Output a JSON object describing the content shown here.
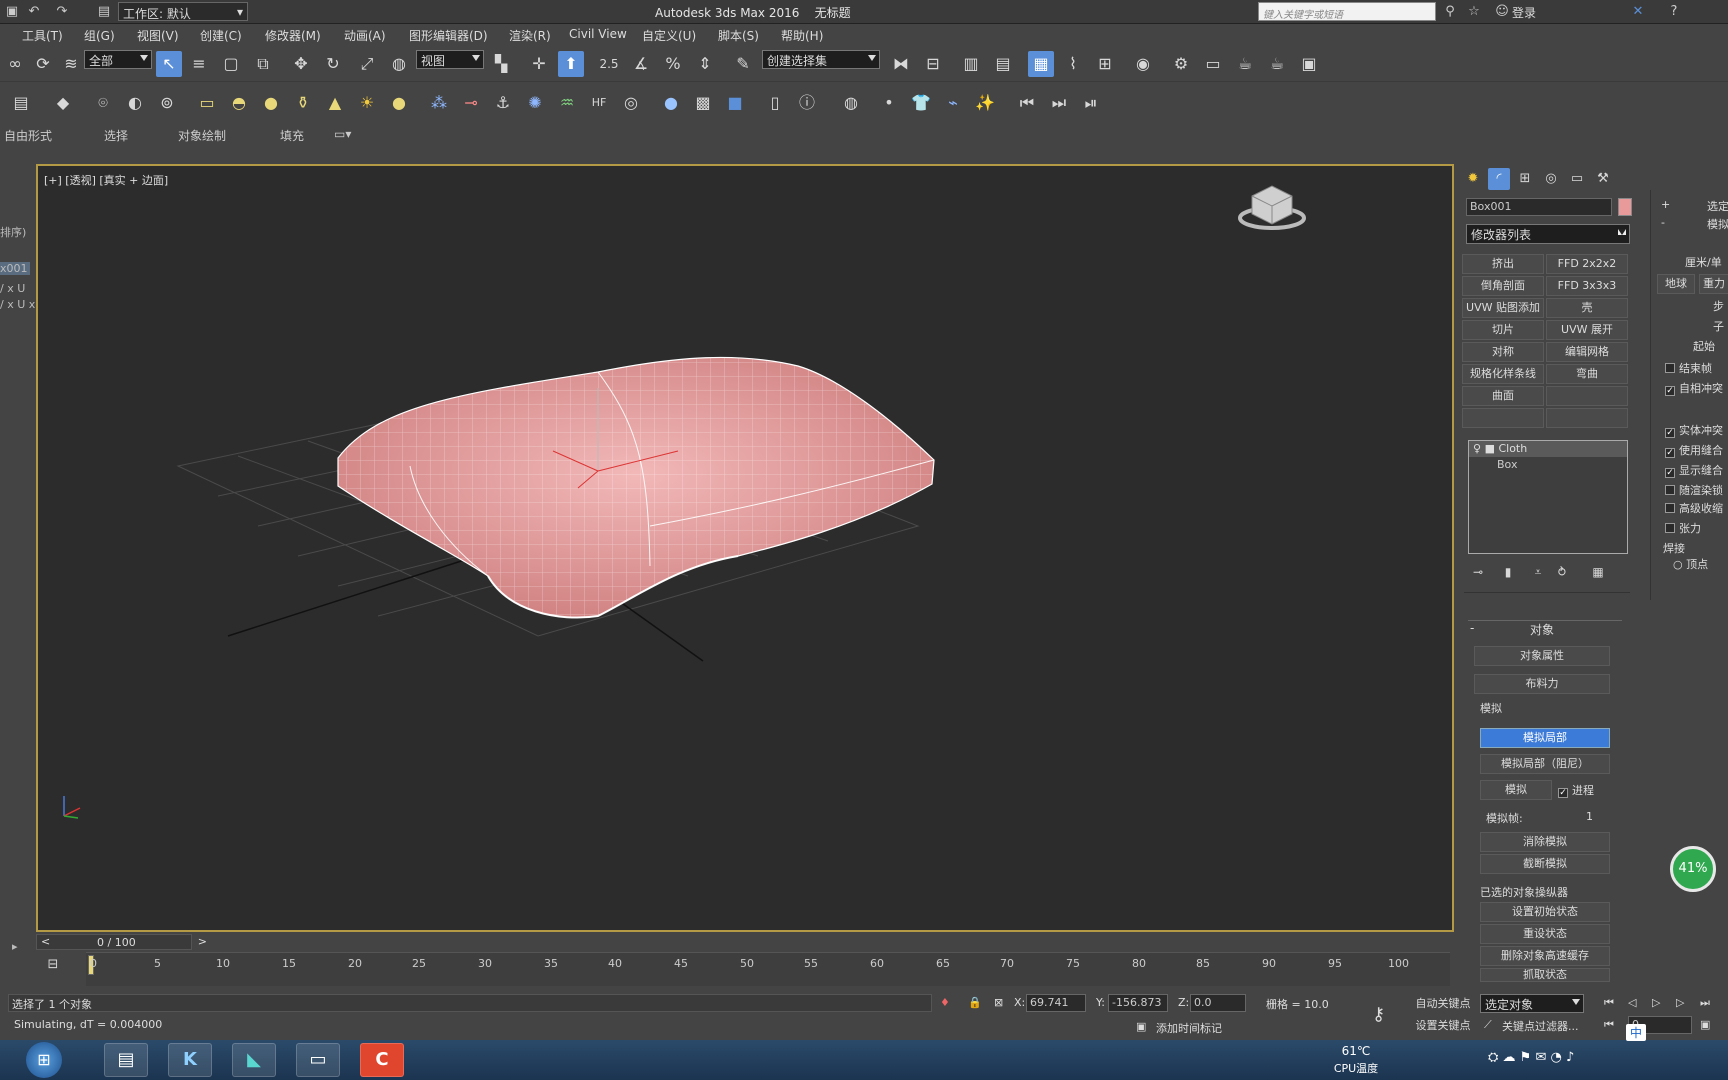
{
  "title": {
    "app": "Autodesk 3ds Max 2016",
    "doc": "无标题",
    "workspace": "工作区: 默认",
    "search_placeholder": "键入关键字或短语",
    "login": "登录"
  },
  "menu": [
    "工具(T)",
    "组(G)",
    "视图(V)",
    "创建(C)",
    "修改器(M)",
    "动画(A)",
    "图形编辑器(D)",
    "渲染(R)",
    "Civil View",
    "自定义(U)",
    "脚本(S)",
    "帮助(H)"
  ],
  "toolbar": {
    "filter": "全部",
    "refcoord": "视图",
    "named_sel": "创建选择集",
    "snap_angle": "2.5"
  },
  "ribbon": [
    "自由形式",
    "选择",
    "对象绘制",
    "填充"
  ],
  "leftpanel": [
    "排序)",
    "x001",
    "/ x U",
    "/ x U x"
  ],
  "viewport": {
    "label": "[+] [透视] [真实 + 边面]"
  },
  "cmd": {
    "object_name": "Box001",
    "object_color": "#e89a9a",
    "modlist": "修改器列表",
    "mod_buttons": [
      [
        "挤出",
        "FFD 2x2x2"
      ],
      [
        "倒角剖面",
        "FFD 3x3x3"
      ],
      [
        "UVW 贴图添加",
        "壳"
      ],
      [
        "切片",
        "UVW 展开"
      ],
      [
        "对称",
        "编辑网格"
      ],
      [
        "规格化样条线",
        "弯曲"
      ],
      [
        "曲面",
        ""
      ]
    ],
    "stack": [
      "Cloth",
      "Box"
    ],
    "rollout_title": "对象",
    "obj_props": "对象属性",
    "cloth_forces": "布料力",
    "sim_group": "模拟",
    "sim_local": "模拟局部",
    "sim_local_damped": "模拟局部（阻尼）",
    "simulate": "模拟",
    "progress": "进程",
    "sim_frame_label": "模拟帧:",
    "sim_frame_value": "1",
    "erase_sim": "消除模拟",
    "truncate_sim": "截断模拟",
    "sel_group": "已选的对象操纵器",
    "set_init": "设置初始状态",
    "reset_state": "重设状态",
    "delete_cache": "删除对象高速缓存",
    "grab_state": "抓取状态"
  },
  "rightpanel": {
    "labels": [
      "选定",
      "模拟",
      "厘米/单",
      "地球",
      "重力",
      "步",
      "子",
      "起始",
      "结束帧",
      "自相冲突",
      "实体冲突",
      "使用缝合",
      "显示缝合",
      "随渲染锁",
      "高级收缩",
      "张力",
      "焊接",
      "顶点"
    ],
    "checks": [
      false,
      true,
      true,
      true,
      true,
      false,
      false,
      false
    ]
  },
  "timeline": {
    "frame": "0 / 100",
    "ticks": [
      "0",
      "5",
      "10",
      "15",
      "20",
      "25",
      "30",
      "35",
      "40",
      "45",
      "50",
      "55",
      "60",
      "65",
      "70",
      "75",
      "80",
      "85",
      "90",
      "95",
      "100"
    ]
  },
  "status": {
    "selected": "选择了 1 个对象",
    "simulating": "Simulating, dT = 0.004000",
    "x": "69.741",
    "y": "-156.873",
    "z": "0.0",
    "grid": "栅格 = 10.0",
    "autokey": "自动关键点",
    "selobj": "选定对象",
    "setkey": "设置关键点",
    "keyfilter": "关键点过滤器...",
    "addtime": "添加时间标记",
    "frame": "0",
    "x_label": "X:",
    "y_label": "Y:",
    "z_label": "Z:"
  },
  "badge": {
    "percent": "41%"
  },
  "taskbar": {
    "temp": "61℃",
    "temp_label": "CPU温度",
    "ime": "中"
  }
}
